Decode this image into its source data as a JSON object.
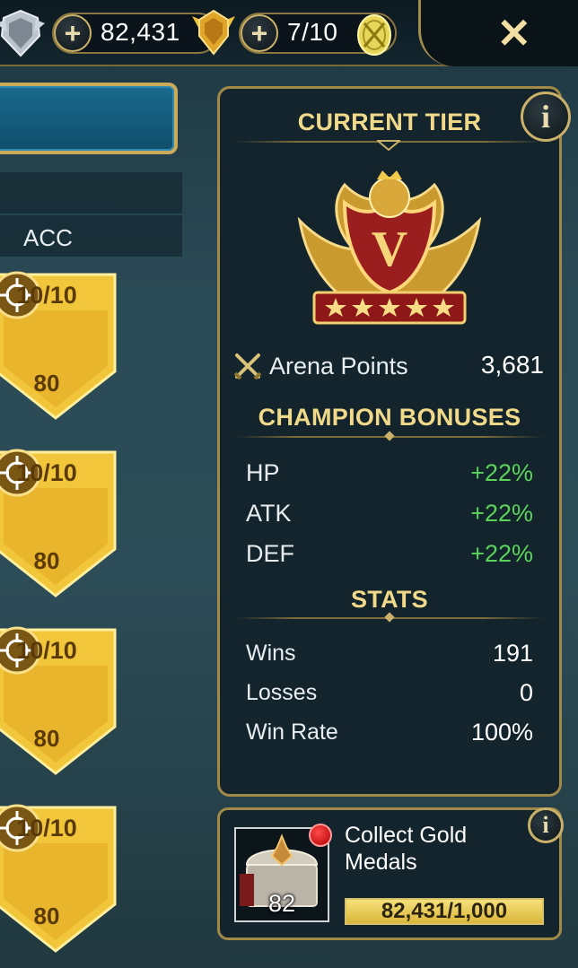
{
  "topbar": {
    "medal_count": "82,431",
    "tokens": "7/10",
    "plus_label": "+",
    "close_label": "✕"
  },
  "left_panel": {
    "column_label": "ACC",
    "rewards": [
      {
        "top": "10/10",
        "bottom": "80"
      },
      {
        "top": "10/10",
        "bottom": "80"
      },
      {
        "top": "10/10",
        "bottom": "80"
      },
      {
        "top": "10/10",
        "bottom": "80"
      }
    ]
  },
  "tier_panel": {
    "info_label": "i",
    "title": "CURRENT TIER",
    "tier_numeral": "V",
    "arena_points_label": "Arena Points",
    "arena_points_value": "3,681",
    "bonuses_title": "CHAMPION BONUSES",
    "bonuses": [
      {
        "label": "HP",
        "value": "+22%"
      },
      {
        "label": "ATK",
        "value": "+22%"
      },
      {
        "label": "DEF",
        "value": "+22%"
      }
    ],
    "stats_title": "STATS",
    "stats": [
      {
        "label": "Wins",
        "value": "191"
      },
      {
        "label": "Losses",
        "value": "0"
      },
      {
        "label": "Win Rate",
        "value": "100%"
      }
    ]
  },
  "collect_panel": {
    "info_label": "i",
    "title": "Collect Gold Medals",
    "chest_count": "82",
    "progress_text": "82,431/1,000",
    "progress_fraction": 1.0
  },
  "colors": {
    "gold": "#f1d98a",
    "bonus_green": "#5bd35b",
    "panel_bg": "#13242c",
    "frame_gold": "#a18a48"
  }
}
